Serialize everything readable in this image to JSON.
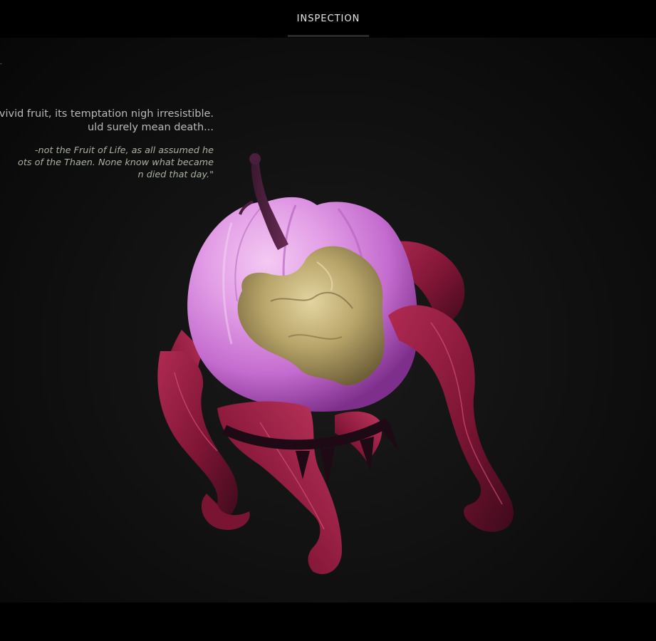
{
  "header": {
    "tabs": [
      {
        "label": "INSPECTION",
        "active": true
      }
    ]
  },
  "item": {
    "description_lines": [
      "vivid fruit, its temptation nigh irresistible.",
      "uld surely mean death..."
    ],
    "quote_lines": [
      "-not the Fruit of Life, as all assumed he",
      "ots of the Thaen. None know what became",
      "n died that day.\""
    ]
  },
  "colors": {
    "background": "#000000",
    "fruit_skin": "#d98ee0",
    "leaf": "#8a1538",
    "flesh": "#b9a66a",
    "tab_text": "#e6e6e6"
  },
  "icons": {
    "model": "fruit-3d-model"
  }
}
